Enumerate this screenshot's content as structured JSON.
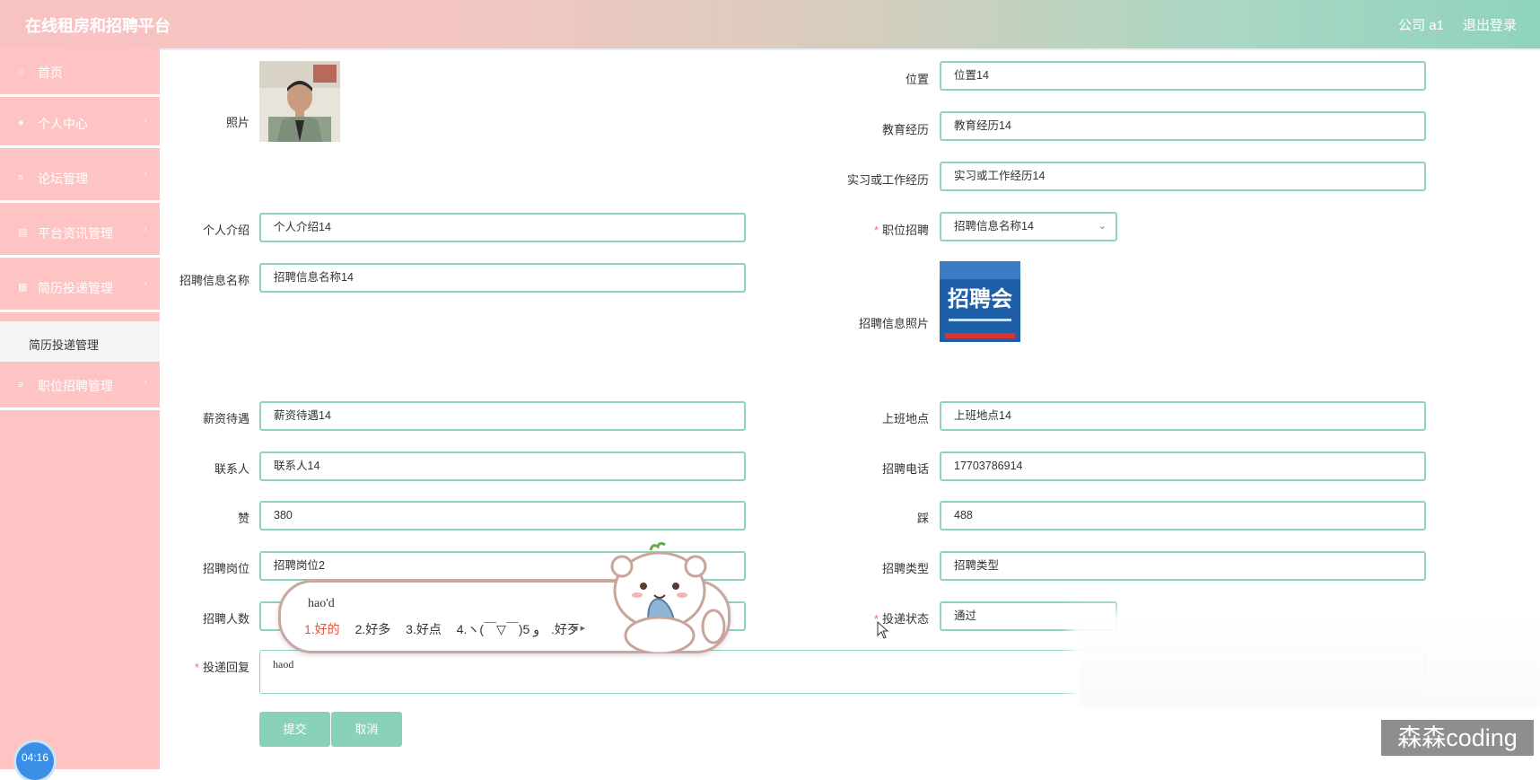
{
  "header": {
    "title": "在线租房和招聘平台",
    "user": "公司 a1",
    "logout": "退出登录"
  },
  "sidebar": {
    "items": [
      {
        "label": "首页",
        "icon": "home-icon"
      },
      {
        "label": "个人中心",
        "icon": "user-icon"
      },
      {
        "label": "论坛管理",
        "icon": "list-icon"
      },
      {
        "label": "平台资讯管理",
        "icon": "news-icon"
      },
      {
        "label": "简历投递管理",
        "icon": "resume-icon"
      },
      {
        "label": "职位招聘管理",
        "icon": "list-icon"
      }
    ],
    "active_sub": "简历投递管理",
    "clock": "04:16"
  },
  "form": {
    "photo_label": "照片",
    "intro_label": "个人介绍",
    "intro_value": "个人介绍14",
    "recruit_name_label": "招聘信息名称",
    "recruit_name_value": "招聘信息名称14",
    "salary_label": "薪资待遇",
    "salary_value": "薪资待遇14",
    "contact_label": "联系人",
    "contact_value": "联系人14",
    "like_label": "赞",
    "like_value": "380",
    "position_label": "招聘岗位",
    "position_value": "招聘岗位2",
    "count_label": "招聘人数",
    "reply_label": "投递回复",
    "reply_value": "haod",
    "location_label": "位置",
    "location_value": "位置14",
    "education_label": "教育经历",
    "education_value": "教育经历14",
    "experience_label": "实习或工作经历",
    "experience_value": "实习或工作经历14",
    "job_label": "职位招聘",
    "job_value": "招聘信息名称14",
    "recruit_photo_label": "招聘信息照片",
    "recruit_photo_text": "招聘会",
    "workplace_label": "上班地点",
    "workplace_value": "上班地点14",
    "phone_label": "招聘电话",
    "phone_value": "17703786914",
    "dislike_label": "踩",
    "dislike_value": "488",
    "type_label": "招聘类型",
    "type_value": "招聘类型",
    "status_label": "投递状态",
    "status_value": "通过",
    "submit": "提交",
    "cancel": "取消"
  },
  "ime": {
    "composition": "hao'd",
    "candidates": [
      "1.好的",
      "2.好多",
      "3.好点",
      "4.ヽ(￣▽￣)و",
      "5.好歹"
    ]
  },
  "watermark": "森森coding"
}
